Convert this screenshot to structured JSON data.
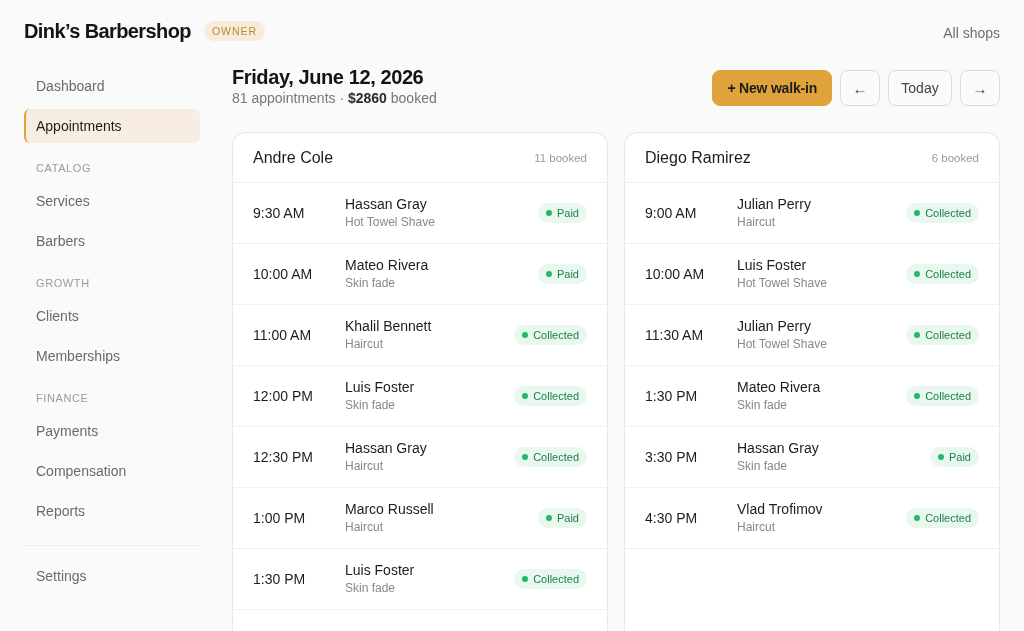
{
  "header": {
    "brand": "Dink’s Barbershop",
    "role_badge": "OWNER",
    "shop_switch": "All shops"
  },
  "sidebar": {
    "items": [
      {
        "kind": "link",
        "label": "Dashboard",
        "selected": false
      },
      {
        "kind": "link",
        "label": "Appointments",
        "selected": true
      },
      {
        "kind": "heading",
        "label": "CATALOG"
      },
      {
        "kind": "link",
        "label": "Services",
        "selected": false
      },
      {
        "kind": "link",
        "label": "Barbers",
        "selected": false
      },
      {
        "kind": "heading",
        "label": "GROWTH"
      },
      {
        "kind": "link",
        "label": "Clients",
        "selected": false
      },
      {
        "kind": "link",
        "label": "Memberships",
        "selected": false
      },
      {
        "kind": "heading",
        "label": "FINANCE"
      },
      {
        "kind": "link",
        "label": "Payments",
        "selected": false
      },
      {
        "kind": "link",
        "label": "Compensation",
        "selected": false
      },
      {
        "kind": "link",
        "label": "Reports",
        "selected": false
      },
      {
        "kind": "divider"
      },
      {
        "kind": "link",
        "label": "Settings",
        "selected": false
      }
    ]
  },
  "page": {
    "title": "Friday, June 12, 2026",
    "summary": "81 appointments · **$2860** booked"
  },
  "toolbar": [
    {
      "kind": "primary",
      "label": "+ New walk-in"
    },
    {
      "kind": "arrow",
      "label": "←"
    },
    {
      "kind": "plain",
      "label": "Today"
    },
    {
      "kind": "arrow",
      "label": "→"
    }
  ],
  "columns": [
    {
      "barber": "Andre Cole",
      "booked": "11 booked",
      "appointments": [
        {
          "time": "9:30 AM",
          "client": "Hassan Gray",
          "service": "Hot Towel Shave",
          "status": "Paid"
        },
        {
          "time": "10:00 AM",
          "client": "Mateo Rivera",
          "service": "Skin fade",
          "status": "Paid"
        },
        {
          "time": "11:00 AM",
          "client": "Khalil Bennett",
          "service": "Haircut",
          "status": "Collected"
        },
        {
          "time": "12:00 PM",
          "client": "Luis Foster",
          "service": "Skin fade",
          "status": "Collected"
        },
        {
          "time": "12:30 PM",
          "client": "Hassan Gray",
          "service": "Haircut",
          "status": "Collected"
        },
        {
          "time": "1:00 PM",
          "client": "Marco Russell",
          "service": "Haircut",
          "status": "Paid"
        },
        {
          "time": "1:30 PM",
          "client": "Luis Foster",
          "service": "Skin fade",
          "status": "Collected"
        }
      ]
    },
    {
      "barber": "Diego Ramirez",
      "booked": "6 booked",
      "appointments": [
        {
          "time": "9:00 AM",
          "client": "Julian Perry",
          "service": "Haircut",
          "status": "Collected"
        },
        {
          "time": "10:00 AM",
          "client": "Luis Foster",
          "service": "Hot Towel Shave",
          "status": "Collected"
        },
        {
          "time": "11:30 AM",
          "client": "Julian Perry",
          "service": "Hot Towel Shave",
          "status": "Collected"
        },
        {
          "time": "1:30 PM",
          "client": "Mateo Rivera",
          "service": "Skin fade",
          "status": "Collected"
        },
        {
          "time": "3:30 PM",
          "client": "Hassan Gray",
          "service": "Skin fade",
          "status": "Paid"
        },
        {
          "time": "4:30 PM",
          "client": "Vlad Trofimov",
          "service": "Haircut",
          "status": "Collected"
        }
      ]
    }
  ]
}
